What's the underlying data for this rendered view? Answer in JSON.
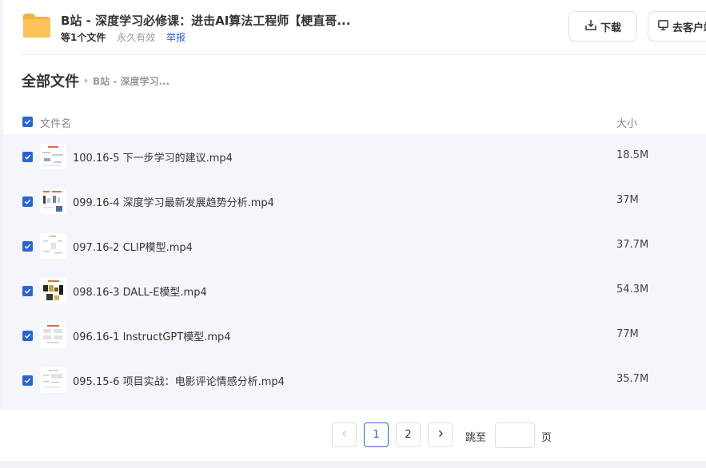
{
  "header": {
    "title": "B站 - 深度学习必修课：进击AI算法工程师【梗直哥...",
    "file_count": "等1个文件",
    "validity": "永久有效",
    "report": "举报",
    "download_label": "下载",
    "client_label": "去客户端"
  },
  "breadcrumb": {
    "root": "全部文件",
    "current": "B站 - 深度学习..."
  },
  "table": {
    "col_name": "文件名",
    "col_size": "大小",
    "rows": [
      {
        "name": "100.16-5 下一步学习的建议.mp4",
        "size": "18.5M",
        "checked": true
      },
      {
        "name": "099.16-4 深度学习最新发展趋势分析.mp4",
        "size": "37M",
        "checked": true
      },
      {
        "name": "097.16-2 CLIP模型.mp4",
        "size": "37.7M",
        "checked": true
      },
      {
        "name": "098.16-3 DALL-E模型.mp4",
        "size": "54.3M",
        "checked": true
      },
      {
        "name": "096.16-1 InstructGPT模型.mp4",
        "size": "77M",
        "checked": true
      },
      {
        "name": "095.15-6 项目实战：电影评论情感分析.mp4",
        "size": "35.7M",
        "checked": true
      }
    ]
  },
  "pagination": {
    "prev_icon": "chevron-left-icon",
    "pages": [
      "1",
      "2"
    ],
    "current_page": "1",
    "next_icon": "chevron-right-icon",
    "jump_label": "跳至",
    "jump_value": "",
    "page_unit": "页"
  },
  "colors": {
    "accent": "#2c64d6",
    "folder": "#fcc35a",
    "row_background": "#f5f6fb"
  }
}
